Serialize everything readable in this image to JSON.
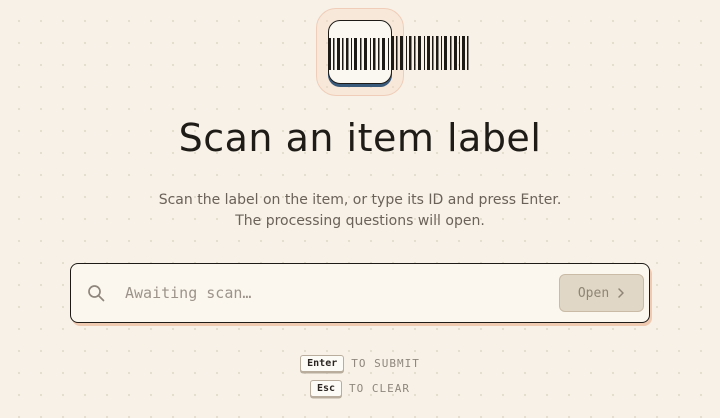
{
  "header": {
    "logo_icon": "barcode-scanner-icon",
    "title": "Scan an item label",
    "subtitle": "Scan the label on the item, or type its ID and press Enter. The processing questions will open."
  },
  "scan": {
    "search_icon": "search-icon",
    "placeholder": "Awaiting scan…",
    "value": "",
    "open_label": "Open",
    "open_icon": "chevron-right-icon"
  },
  "hints": [
    {
      "key": "Enter",
      "text": "TO SUBMIT"
    },
    {
      "key": "Esc",
      "text": "TO CLEAR"
    }
  ],
  "colors": {
    "background": "#f7f1e7",
    "accent_shadow": "#f0c9b1",
    "ink": "#1f1c18",
    "button_disabled": "#e1d7c6"
  }
}
